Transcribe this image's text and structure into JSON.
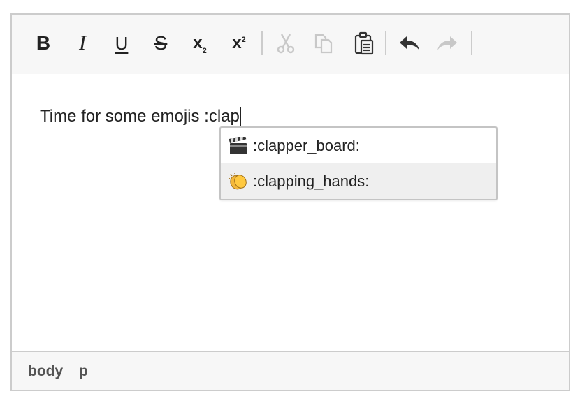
{
  "toolbar": {
    "buttons": [
      {
        "id": "bold",
        "glyph": "B",
        "enabled": true
      },
      {
        "id": "italic",
        "glyph": "I",
        "enabled": true
      },
      {
        "id": "underline",
        "glyph": "U",
        "enabled": true
      },
      {
        "id": "strikethrough",
        "glyph": "S",
        "enabled": true
      },
      {
        "id": "subscript",
        "glyph": "x",
        "enabled": true
      },
      {
        "id": "superscript",
        "glyph": "x",
        "enabled": true
      },
      {
        "id": "cut",
        "enabled": false
      },
      {
        "id": "copy",
        "enabled": false
      },
      {
        "id": "paste",
        "enabled": true
      },
      {
        "id": "undo",
        "enabled": true
      },
      {
        "id": "redo",
        "enabled": false
      }
    ]
  },
  "content": {
    "text": "Time for some emojis :clap"
  },
  "autocomplete": {
    "items": [
      {
        "emoji": "🎬",
        "label": ":clapper_board:",
        "active": false
      },
      {
        "emoji": "👏",
        "label": ":clapping_hands:",
        "active": true
      }
    ]
  },
  "statusbar": {
    "path": [
      "body",
      "p"
    ]
  },
  "colors": {
    "toolbar_bg": "#f7f7f7",
    "border": "#cccccc",
    "active_item": "#efefef",
    "disabled_icon": "#c8c8c8"
  }
}
